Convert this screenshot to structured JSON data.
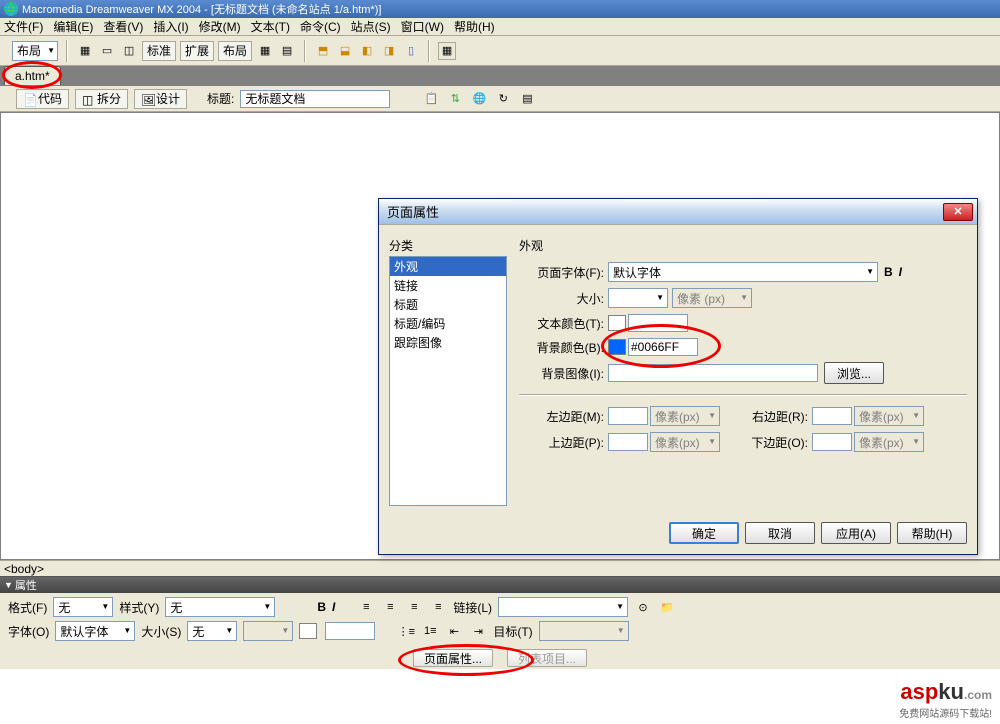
{
  "title": "Macromedia Dreamweaver MX 2004 - [无标题文档 (未命名站点 1/a.htm*)]",
  "menu": {
    "file": "文件(F)",
    "edit": "编辑(E)",
    "view": "查看(V)",
    "insert": "插入(I)",
    "modify": "修改(M)",
    "text": "文本(T)",
    "commands": "命令(C)",
    "site": "站点(S)",
    "window": "窗口(W)",
    "help": "帮助(H)"
  },
  "toolbar": {
    "layout": "布局",
    "std": "标准",
    "ext": "扩展",
    "layout2": "布局"
  },
  "tab": {
    "name": "a.htm*"
  },
  "toolbar2": {
    "code": "代码",
    "split": "拆分",
    "design": "设计",
    "title_label": "标题:",
    "title_value": "无标题文档"
  },
  "dialog": {
    "title": "页面属性",
    "cat_label": "分类",
    "categories": [
      "外观",
      "链接",
      "标题",
      "标题/编码",
      "跟踪图像"
    ],
    "panel_title": "外观",
    "font_label": "页面字体(F):",
    "font_value": "默认字体",
    "size_label": "大小:",
    "size_unit": "像素 (px)",
    "textcolor_label": "文本颜色(T):",
    "bgcolor_label": "背景颜色(B):",
    "bgcolor_value": "#0066FF",
    "bgimage_label": "背景图像(I):",
    "browse": "浏览...",
    "left_label": "左边距(M):",
    "right_label": "右边距(R):",
    "top_label": "上边距(P):",
    "bottom_label": "下边距(O):",
    "px": "像素(px)",
    "ok": "确定",
    "cancel": "取消",
    "apply": "应用(A)",
    "help": "帮助(H)"
  },
  "status": {
    "body": "<body>"
  },
  "props": {
    "title": "属性",
    "format_label": "格式(F)",
    "format_value": "无",
    "style_label": "样式(Y)",
    "style_value": "无",
    "font_label": "字体(O)",
    "font_value": "默认字体",
    "size_label": "大小(S)",
    "size_value": "无",
    "link_label": "链接(L)",
    "target_label": "目标(T)",
    "pageprops": "页面属性...",
    "listitem": "列表项目..."
  },
  "watermark": {
    "brand": "aspku",
    "ext": ".com",
    "tag": "免费网站源码下载站!"
  }
}
